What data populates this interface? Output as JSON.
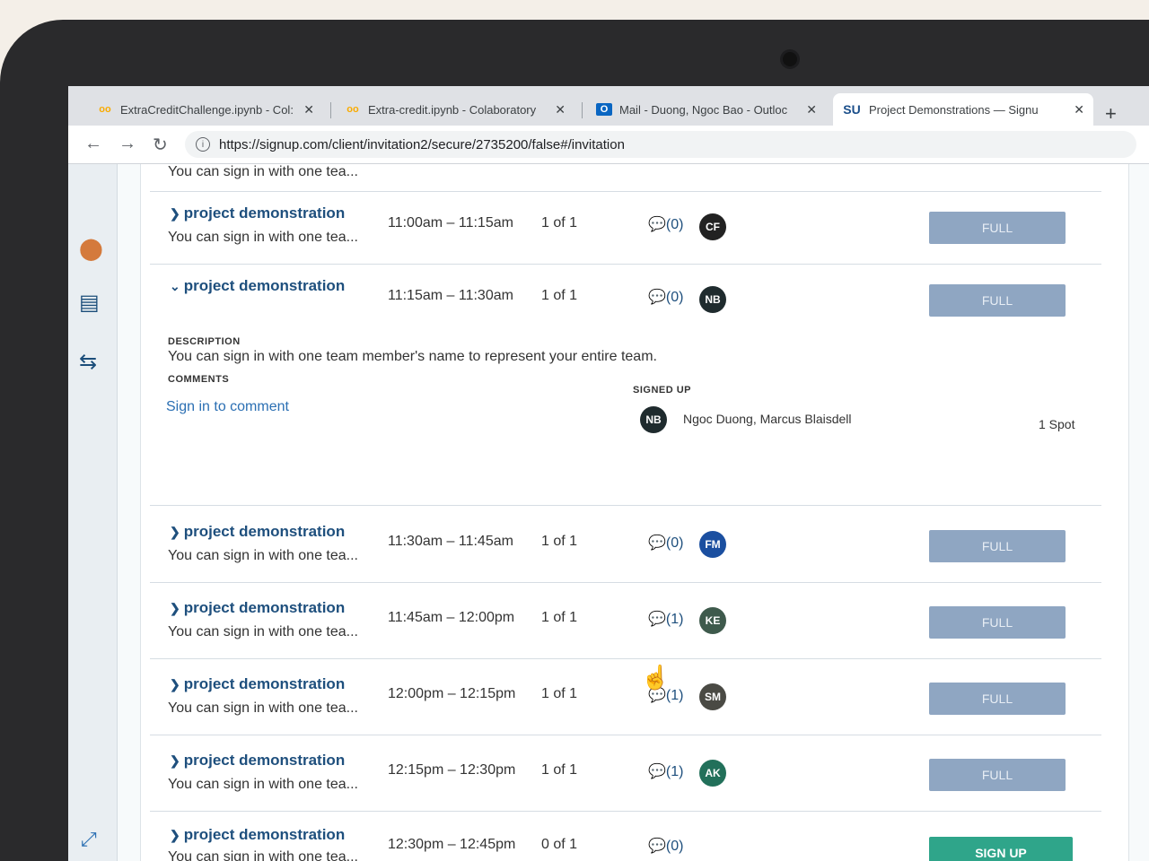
{
  "browser": {
    "tabs": [
      {
        "title": "ExtraCreditChallenge.ipynb - Col:",
        "icon": "colab-icon",
        "active": false
      },
      {
        "title": "Extra-credit.ipynb - Colaboratory",
        "icon": "colab-icon",
        "active": false
      },
      {
        "title": "Mail - Duong, Ngoc Bao - Outloc",
        "icon": "outlook-icon",
        "active": false
      },
      {
        "title": "Project Demonstrations — Signu",
        "icon": "signup-icon",
        "favicon_text": "SU",
        "active": true
      }
    ],
    "url": "https://signup.com/client/invitation2/secure/2735200/false#/invitation"
  },
  "slots_top": [
    {
      "title": "project demonstration",
      "desc": "You can sign in with one tea...",
      "time": "11:00am – 11:15am",
      "count": "1 of 1",
      "comments": "(0)",
      "initials": "CF",
      "avatar_color": "#222222",
      "button": "FULL"
    },
    {
      "title": "project demonstration",
      "time": "11:15am – 11:30am",
      "count": "1 of 1",
      "comments": "(0)",
      "initials": "NB",
      "avatar_color": "#1f2b2e",
      "button": "FULL"
    }
  ],
  "partial_top_desc": "You can sign in with one tea...",
  "expanded": {
    "description_label": "DESCRIPTION",
    "description": "You can sign in with one team member's name to represent your entire team.",
    "comments_label": "COMMENTS",
    "signed_up_label": "SIGNED UP",
    "sign_in_link": "Sign in to comment",
    "initials": "NB",
    "names": "Ngoc Duong, Marcus Blaisdell",
    "spot": "1 Spot"
  },
  "slots_bottom": [
    {
      "title": "project demonstration",
      "desc": "You can sign in with one tea...",
      "time": "11:30am – 11:45am",
      "count": "1 of 1",
      "comments": "(0)",
      "initials": "FM",
      "avatar_color": "#1b4fa0",
      "button": "FULL"
    },
    {
      "title": "project demonstration",
      "desc": "You can sign in with one tea...",
      "time": "11:45am – 12:00pm",
      "count": "1 of 1",
      "comments": "(1)",
      "initials": "KE",
      "avatar_color": "#3e5a4c",
      "button": "FULL"
    },
    {
      "title": "project demonstration",
      "desc": "You can sign in with one tea...",
      "time": "12:00pm – 12:15pm",
      "count": "1 of 1",
      "comments": "(1)",
      "initials": "SM",
      "avatar_color": "#4a4a44",
      "button": "FULL"
    },
    {
      "title": "project demonstration",
      "desc": "You can sign in with one tea...",
      "time": "12:15pm – 12:30pm",
      "count": "1 of 1",
      "comments": "(1)",
      "initials": "AK",
      "avatar_color": "#22705a",
      "button": "FULL"
    },
    {
      "title": "project demonstration",
      "desc": "You can sign in with one tea...",
      "time": "12:30pm – 12:45pm",
      "count": "0 of 1",
      "comments": "(0)",
      "button": "SIGN UP"
    }
  ]
}
